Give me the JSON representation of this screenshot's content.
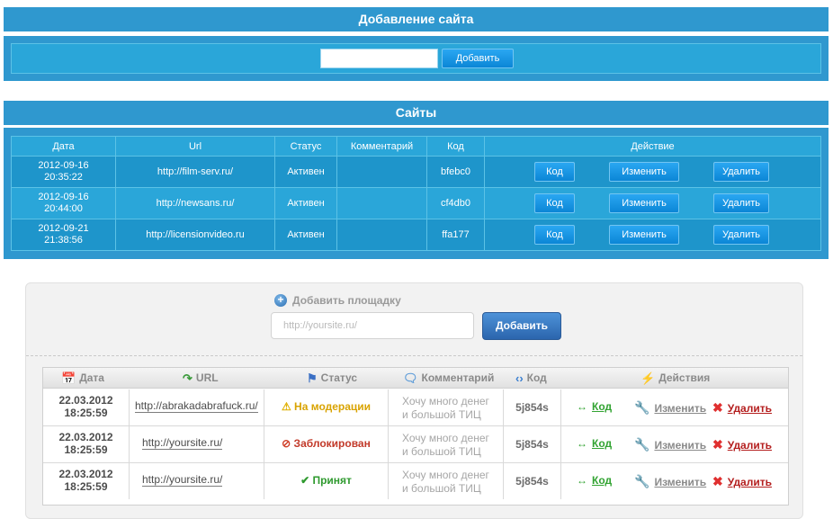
{
  "top": {
    "add_title": "Добавление сайта",
    "add_button": "Добавить",
    "sites_title": "Сайты",
    "columns": [
      "Дата",
      "Url",
      "Статус",
      "Комментарий",
      "Код",
      "Действие"
    ],
    "rows": [
      {
        "date": "2012-09-16",
        "time": "20:35:22",
        "url": "http://film-serv.ru/",
        "status": "Активен",
        "comment": "",
        "code": "bfebc0"
      },
      {
        "date": "2012-09-16",
        "time": "20:44:00",
        "url": "http://newsans.ru/",
        "status": "Активен",
        "comment": "",
        "code": "cf4db0"
      },
      {
        "date": "2012-09-21",
        "time": "21:38:56",
        "url": "http://licensionvideo.ru",
        "status": "Активен",
        "comment": "",
        "code": "ffa177"
      }
    ],
    "btn_code": "Код",
    "btn_edit": "Изменить",
    "btn_delete": "Удалить"
  },
  "bottom": {
    "add_title": "Добавить площадку",
    "url_placeholder": "http://yoursite.ru/",
    "add_button": "Добавить",
    "columns": {
      "date": "Дата",
      "url": "URL",
      "status": "Статус",
      "comment": "Комментарий",
      "code": "Код",
      "actions": "Действия"
    },
    "rows": [
      {
        "date": "22.03.2012",
        "time": "18:25:59",
        "url": "http://abrakadabrafuck.ru/",
        "status": "На модерации",
        "status_icon": "warning-icon",
        "status_color": "#d9a300",
        "comment1": "Хочу много денег",
        "comment2": "и большой ТИЦ",
        "code": "5j854s"
      },
      {
        "date": "22.03.2012",
        "time": "18:25:59",
        "url": "http://yoursite.ru/",
        "status": "Заблокирован",
        "status_icon": "blocked-icon",
        "status_color": "#c23a2a",
        "comment1": "Хочу много денег",
        "comment2": "и большой ТИЦ",
        "code": "5j854s"
      },
      {
        "date": "22.03.2012",
        "time": "18:25:59",
        "url": "http://yoursite.ru/",
        "status": "Принят",
        "status_icon": "check-icon",
        "status_color": "#2f9a2f",
        "comment1": "Хочу много денег",
        "comment2": "и большой ТИЦ",
        "code": "5j854s"
      }
    ],
    "act_code": "Код",
    "act_edit": "Изменить",
    "act_delete": "Удалить"
  },
  "colors": {
    "top_bar": "#2f98cf",
    "top_panel": "#2aa6d9",
    "button_blue": "#0b86d6",
    "code_green": "#32a332",
    "delete_red": "#b41e1e"
  }
}
